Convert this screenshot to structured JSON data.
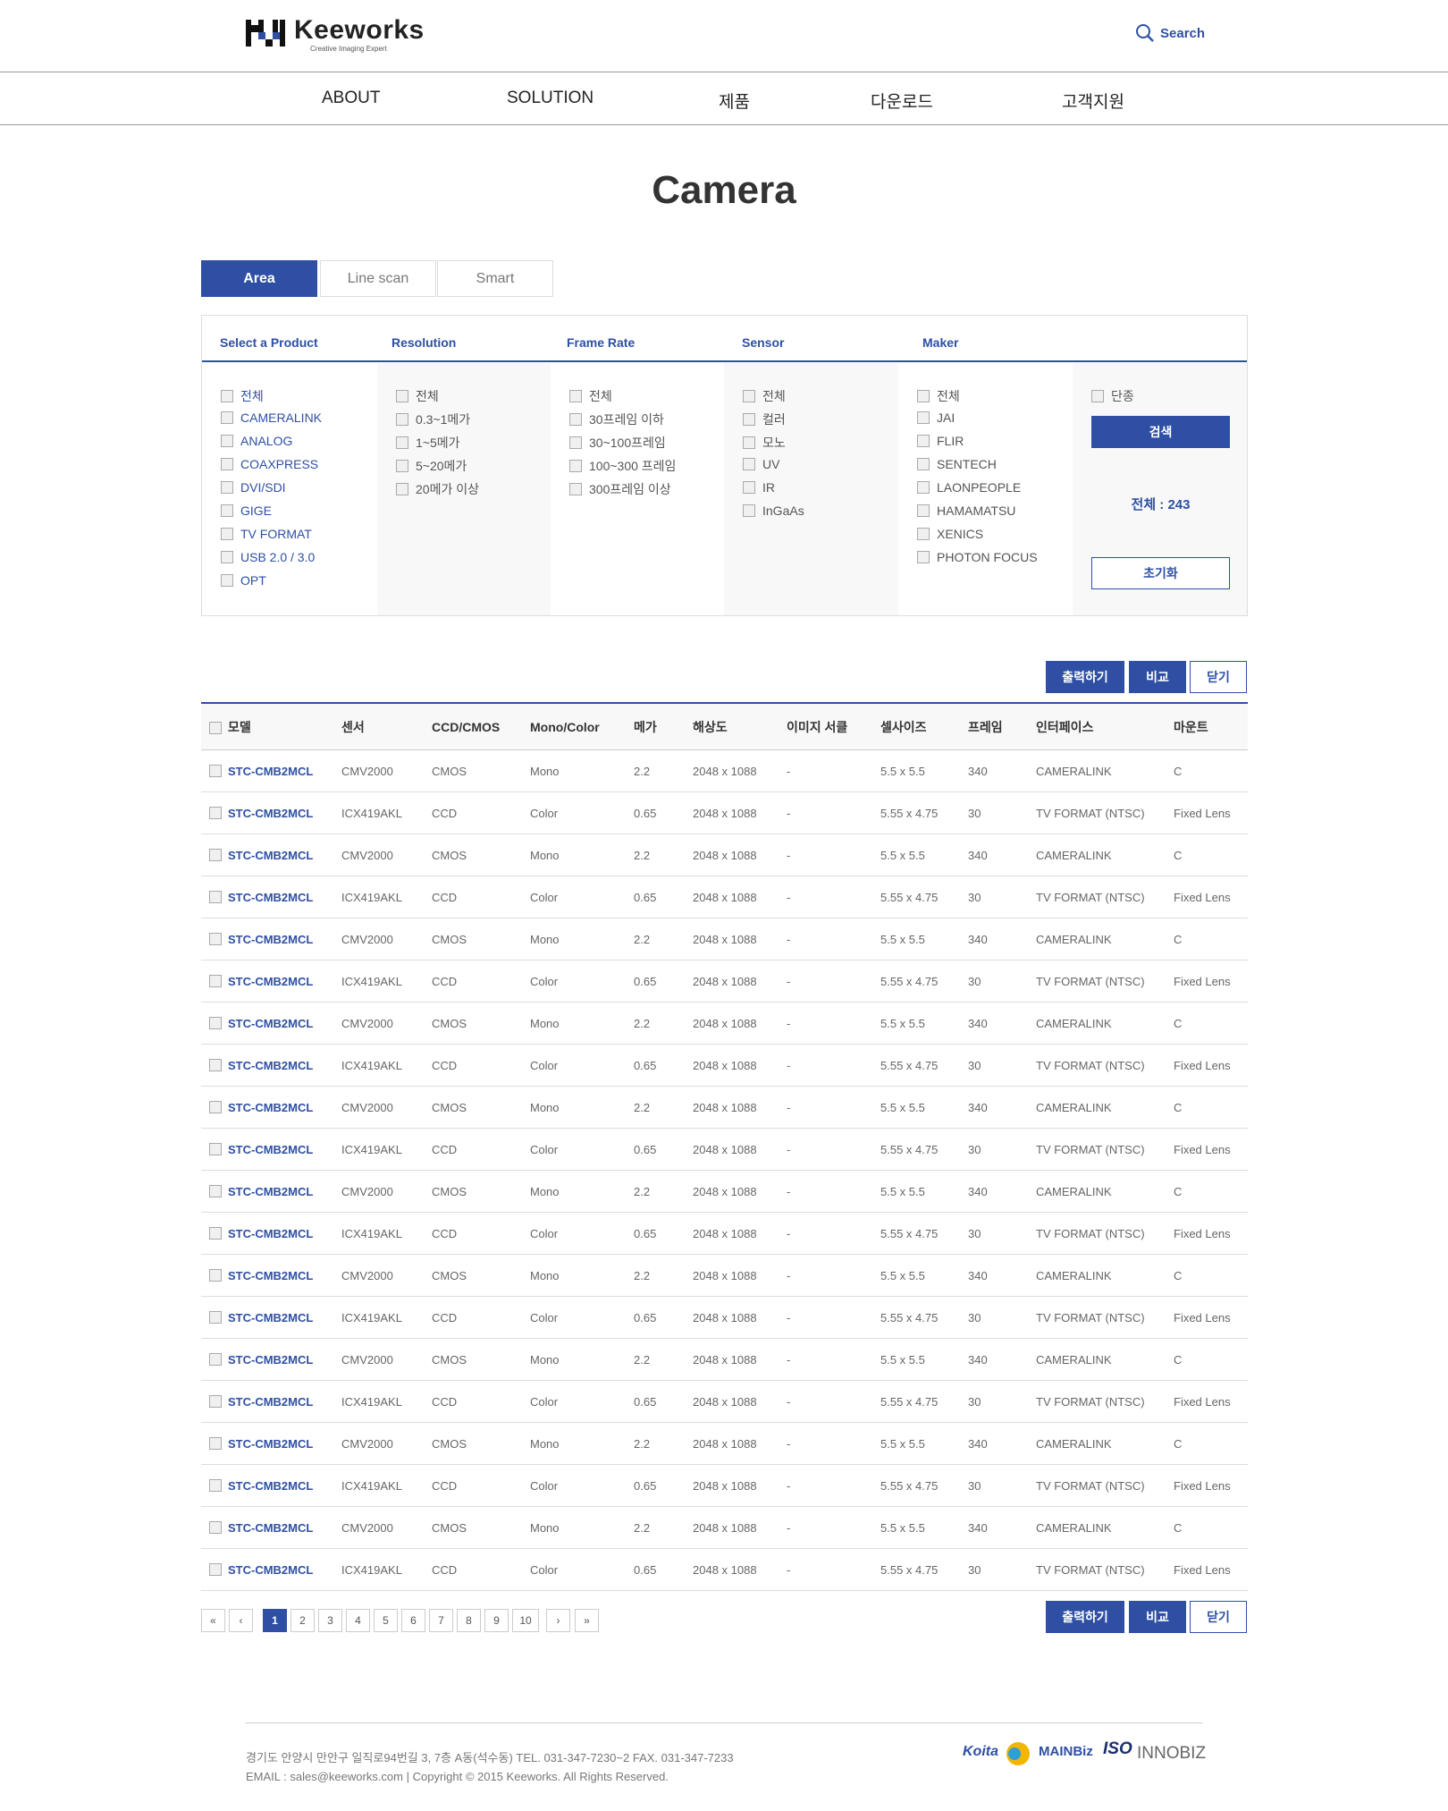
{
  "header": {
    "logo_name": "Keeworks",
    "logo_tagline": "Creative  Imaging  Expert",
    "search_label": "Search"
  },
  "nav": [
    "ABOUT",
    "SOLUTION",
    "제품",
    "다운로드",
    "고객지원"
  ],
  "page_title": "Camera",
  "tabs": [
    {
      "label": "Area",
      "active": true
    },
    {
      "label": "Line scan",
      "active": false
    },
    {
      "label": "Smart",
      "active": false
    }
  ],
  "filter": {
    "headers": [
      "Select a Product",
      "Resolution",
      "Frame Rate",
      "Sensor",
      "Maker"
    ],
    "products": [
      "전체",
      "CAMERALINK",
      "ANALOG",
      "COAXPRESS",
      "DVI/SDI",
      "GIGE",
      "TV FORMAT",
      "USB 2.0 / 3.0",
      "OPT"
    ],
    "resolution": [
      "전체",
      "0.3~1메가",
      "1~5메가",
      "5~20메가",
      "20메가 이상"
    ],
    "frame_rate": [
      "전체",
      "30프레임 이하",
      "30~100프레임",
      "100~300 프레임",
      "300프레임 이상"
    ],
    "sensor": [
      "전체",
      "컬러",
      "모노",
      "UV",
      "IR",
      "InGaAs"
    ],
    "maker": [
      "전체",
      "JAI",
      "FLIR",
      "SENTECH",
      "LAONPEOPLE",
      "HAMAMATSU",
      "XENICS",
      "PHOTON FOCUS"
    ],
    "discontinued": "단종",
    "search_button": "검색",
    "total": "전체 : 243",
    "reset_button": "초기화"
  },
  "actions": {
    "print": "출력하기",
    "compare": "비교",
    "close": "닫기"
  },
  "table": {
    "columns": [
      "모델",
      "센서",
      "CCD/CMOS",
      "Mono/Color",
      "메가",
      "해상도",
      "이미지 서클",
      "셀사이즈",
      "프레임",
      "인터페이스",
      "마운트"
    ],
    "rows": [
      [
        "STC-CMB2MCL",
        "CMV2000",
        "CMOS",
        "Mono",
        "2.2",
        "2048 x 1088",
        "-",
        "5.5 x 5.5",
        "340",
        "CAMERALINK",
        "C"
      ],
      [
        "STC-CMB2MCL",
        "ICX419AKL",
        "CCD",
        "Color",
        "0.65",
        "2048 x 1088",
        "-",
        "5.55 x 4.75",
        "30",
        "TV FORMAT (NTSC)",
        "Fixed Lens"
      ],
      [
        "STC-CMB2MCL",
        "CMV2000",
        "CMOS",
        "Mono",
        "2.2",
        "2048 x 1088",
        "-",
        "5.5 x 5.5",
        "340",
        "CAMERALINK",
        "C"
      ],
      [
        "STC-CMB2MCL",
        "ICX419AKL",
        "CCD",
        "Color",
        "0.65",
        "2048 x 1088",
        "-",
        "5.55 x 4.75",
        "30",
        "TV FORMAT (NTSC)",
        "Fixed Lens"
      ],
      [
        "STC-CMB2MCL",
        "CMV2000",
        "CMOS",
        "Mono",
        "2.2",
        "2048 x 1088",
        "-",
        "5.5 x 5.5",
        "340",
        "CAMERALINK",
        "C"
      ],
      [
        "STC-CMB2MCL",
        "ICX419AKL",
        "CCD",
        "Color",
        "0.65",
        "2048 x 1088",
        "-",
        "5.55 x 4.75",
        "30",
        "TV FORMAT (NTSC)",
        "Fixed Lens"
      ],
      [
        "STC-CMB2MCL",
        "CMV2000",
        "CMOS",
        "Mono",
        "2.2",
        "2048 x 1088",
        "-",
        "5.5 x 5.5",
        "340",
        "CAMERALINK",
        "C"
      ],
      [
        "STC-CMB2MCL",
        "ICX419AKL",
        "CCD",
        "Color",
        "0.65",
        "2048 x 1088",
        "-",
        "5.55 x 4.75",
        "30",
        "TV FORMAT (NTSC)",
        "Fixed Lens"
      ],
      [
        "STC-CMB2MCL",
        "CMV2000",
        "CMOS",
        "Mono",
        "2.2",
        "2048 x 1088",
        "-",
        "5.5 x 5.5",
        "340",
        "CAMERALINK",
        "C"
      ],
      [
        "STC-CMB2MCL",
        "ICX419AKL",
        "CCD",
        "Color",
        "0.65",
        "2048 x 1088",
        "-",
        "5.55 x 4.75",
        "30",
        "TV FORMAT (NTSC)",
        "Fixed Lens"
      ],
      [
        "STC-CMB2MCL",
        "CMV2000",
        "CMOS",
        "Mono",
        "2.2",
        "2048 x 1088",
        "-",
        "5.5 x 5.5",
        "340",
        "CAMERALINK",
        "C"
      ],
      [
        "STC-CMB2MCL",
        "ICX419AKL",
        "CCD",
        "Color",
        "0.65",
        "2048 x 1088",
        "-",
        "5.55 x 4.75",
        "30",
        "TV FORMAT (NTSC)",
        "Fixed Lens"
      ],
      [
        "STC-CMB2MCL",
        "CMV2000",
        "CMOS",
        "Mono",
        "2.2",
        "2048 x 1088",
        "-",
        "5.5 x 5.5",
        "340",
        "CAMERALINK",
        "C"
      ],
      [
        "STC-CMB2MCL",
        "ICX419AKL",
        "CCD",
        "Color",
        "0.65",
        "2048 x 1088",
        "-",
        "5.55 x 4.75",
        "30",
        "TV FORMAT (NTSC)",
        "Fixed Lens"
      ],
      [
        "STC-CMB2MCL",
        "CMV2000",
        "CMOS",
        "Mono",
        "2.2",
        "2048 x 1088",
        "-",
        "5.5 x 5.5",
        "340",
        "CAMERALINK",
        "C"
      ],
      [
        "STC-CMB2MCL",
        "ICX419AKL",
        "CCD",
        "Color",
        "0.65",
        "2048 x 1088",
        "-",
        "5.55 x 4.75",
        "30",
        "TV FORMAT (NTSC)",
        "Fixed Lens"
      ],
      [
        "STC-CMB2MCL",
        "CMV2000",
        "CMOS",
        "Mono",
        "2.2",
        "2048 x 1088",
        "-",
        "5.5 x 5.5",
        "340",
        "CAMERALINK",
        "C"
      ],
      [
        "STC-CMB2MCL",
        "ICX419AKL",
        "CCD",
        "Color",
        "0.65",
        "2048 x 1088",
        "-",
        "5.55 x 4.75",
        "30",
        "TV FORMAT (NTSC)",
        "Fixed Lens"
      ],
      [
        "STC-CMB2MCL",
        "CMV2000",
        "CMOS",
        "Mono",
        "2.2",
        "2048 x 1088",
        "-",
        "5.5 x 5.5",
        "340",
        "CAMERALINK",
        "C"
      ],
      [
        "STC-CMB2MCL",
        "ICX419AKL",
        "CCD",
        "Color",
        "0.65",
        "2048 x 1088",
        "-",
        "5.55 x 4.75",
        "30",
        "TV FORMAT (NTSC)",
        "Fixed Lens"
      ]
    ]
  },
  "pagination": {
    "first": "«",
    "prev": "‹",
    "next": "›",
    "last": "»",
    "pages": [
      "1",
      "2",
      "3",
      "4",
      "5",
      "6",
      "7",
      "8",
      "9",
      "10"
    ],
    "current": "1"
  },
  "footer": {
    "address": "경기도 안양시 만안구 일직로94번길 3, 7층 A동(석수동)    TEL. 031-347-7230~2  FAX. 031-347-7233",
    "copyright": "EMAIL : sales@keeworks.com | Copyright © 2015 Keeworks. All Rights Reserved.",
    "certs": [
      "Koita",
      "MAINBiz",
      "ISO",
      "INNOBIZ"
    ]
  },
  "colors": {
    "accent": "#2e4fa3",
    "border": "#dddddd",
    "panel_gray": "#f8f8f8"
  }
}
